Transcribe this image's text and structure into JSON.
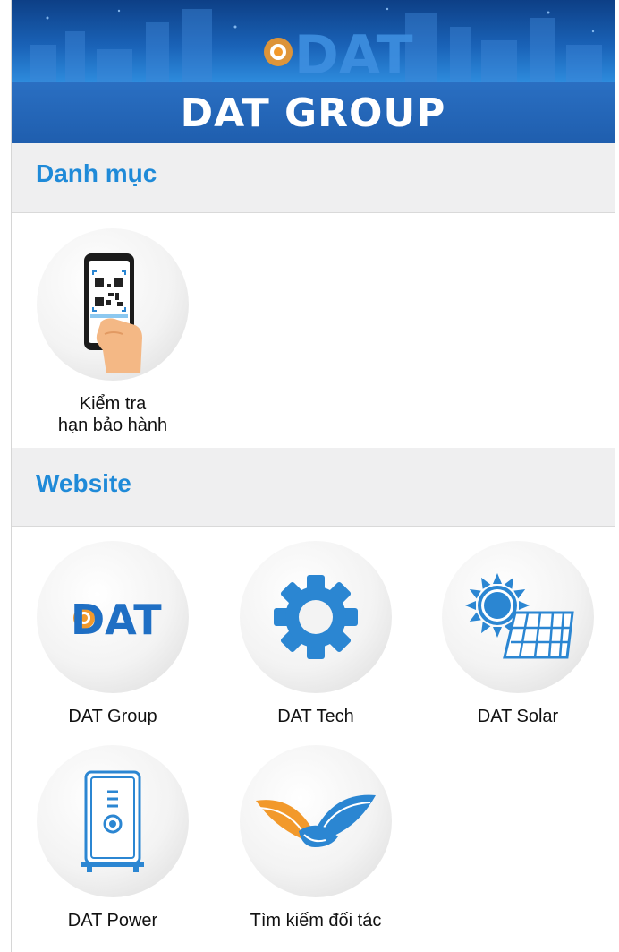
{
  "header": {
    "logo_text": "DAT",
    "title": "DAT GROUP"
  },
  "sections": {
    "danh_muc": {
      "title": "Danh mục",
      "items": [
        {
          "label_line1": "Kiểm tra",
          "label_line2": "hạn bảo hành",
          "icon": "qr-phone-icon"
        }
      ]
    },
    "website": {
      "title": "Website",
      "items": [
        {
          "label": "DAT Group",
          "icon": "dat-logo-icon",
          "logo_text": "DAT"
        },
        {
          "label": "DAT Tech",
          "icon": "gear-icon"
        },
        {
          "label": "DAT Solar",
          "icon": "solar-panel-icon"
        },
        {
          "label": "DAT Power",
          "icon": "power-unit-icon"
        },
        {
          "label": "Tìm kiếm đối tác",
          "icon": "handshake-icon"
        }
      ]
    }
  },
  "colors": {
    "accent": "#1f8ad8",
    "banner_band": "#1f5eae",
    "section_bg": "#efeff0",
    "icon_blue": "#2b86d2",
    "icon_orange": "#f2992b"
  }
}
